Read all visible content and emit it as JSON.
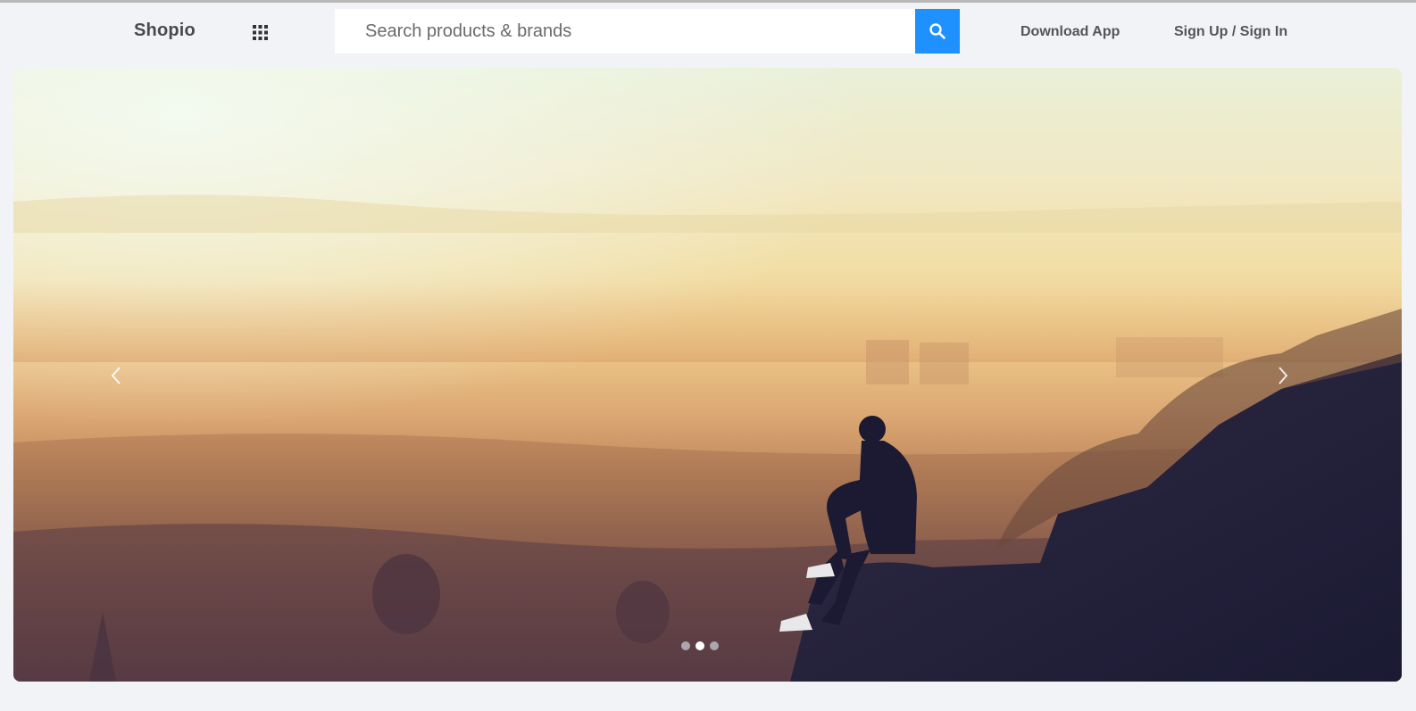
{
  "navbar": {
    "brand": "Shopio",
    "apps_icon": "grid-apps-icon",
    "search": {
      "placeholder": "Search products & brands",
      "value": "",
      "button_icon": "search-icon",
      "button_color": "#1e90ff"
    },
    "links": {
      "download": "Download App",
      "signin": "Sign Up / Sign In"
    }
  },
  "carousel": {
    "image_alt": "Person sitting on a rock overlooking a hazy city at sunset",
    "prev_icon": "chevron-left-icon",
    "next_icon": "chevron-right-icon",
    "slide_count": 3,
    "active_slide": 2
  },
  "colors": {
    "page_bg": "#f2f3f7",
    "accent": "#1e90ff"
  }
}
